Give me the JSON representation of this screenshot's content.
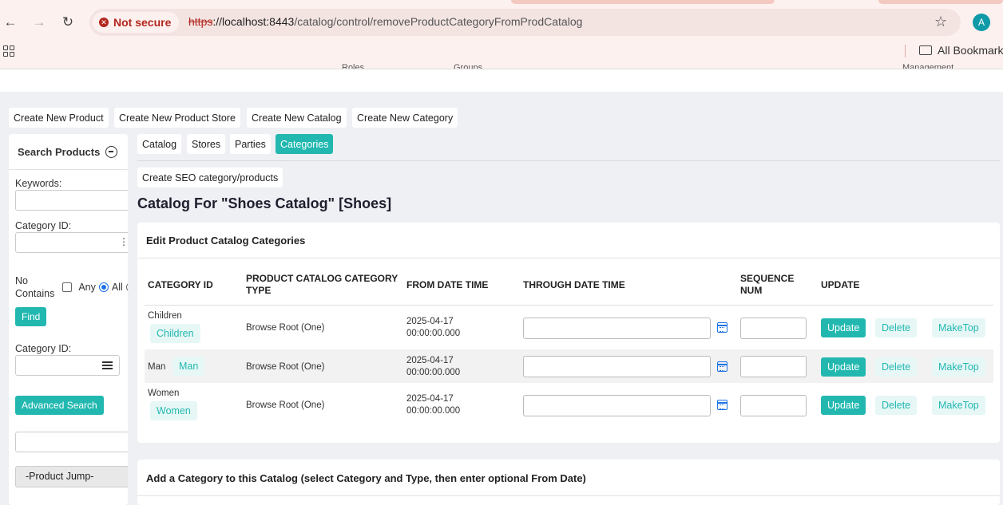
{
  "browser": {
    "security_label": "Not secure",
    "url_scheme": "https",
    "url_host": "://localhost:8443",
    "url_path": "/catalog/control/removeProductCategoryFromProdCatalog",
    "profile_initial": "A",
    "bookmarks_label": "All Bookmarks",
    "cut_menu_items": [
      "Roles",
      "Groups",
      "Management"
    ]
  },
  "top_buttons": [
    "Create New Product",
    "Create New Product Store",
    "Create New Catalog",
    "Create New Category"
  ],
  "sidebar": {
    "title": "Search Products",
    "keywords_label": "Keywords:",
    "category_id_label": "Category ID:",
    "no_contains_label": "No Contains",
    "any_label": "Any",
    "all_label": "All",
    "find_label": "Find",
    "category_id_label_2": "Category ID:",
    "advanced_search_label": "Advanced Search",
    "product_jump_label": "-Product Jump-"
  },
  "tabs": [
    {
      "label": "Catalog",
      "active": false
    },
    {
      "label": "Stores",
      "active": false
    },
    {
      "label": "Parties",
      "active": false
    },
    {
      "label": "Categories",
      "active": true
    }
  ],
  "seo_button": "Create SEO category/products",
  "page_title": "Catalog For \"Shoes Catalog\" [Shoes]",
  "edit_card": {
    "title": "Edit Product Catalog Categories",
    "headers": {
      "category_id": "CATEGORY ID",
      "type": "PRODUCT CATALOG CATEGORY TYPE",
      "from_date": "FROM DATE TIME",
      "through_date": "THROUGH DATE TIME",
      "sequence": "SEQUENCE NUM",
      "update": "UPDATE"
    },
    "rows": [
      {
        "category_id": "Children",
        "link": "Children",
        "type": "Browse Root (One)",
        "from_date": "2025-04-17",
        "from_time": "00:00:00.000"
      },
      {
        "category_id": "Man",
        "link": "Man",
        "type": "Browse Root (One)",
        "from_date": "2025-04-17",
        "from_time": "00:00:00.000"
      },
      {
        "category_id": "Women",
        "link": "Women",
        "type": "Browse Root (One)",
        "from_date": "2025-04-17",
        "from_time": "00:00:00.000"
      }
    ],
    "update_label": "Update",
    "delete_label": "Delete",
    "maketop_label": "MakeTop"
  },
  "add_card": {
    "title": "Add a Category to this Catalog (select Category and Type, then enter optional From Date)"
  },
  "colors": {
    "accent": "#22b8b0",
    "danger": "#b3261e",
    "link": "#1a73e8"
  }
}
